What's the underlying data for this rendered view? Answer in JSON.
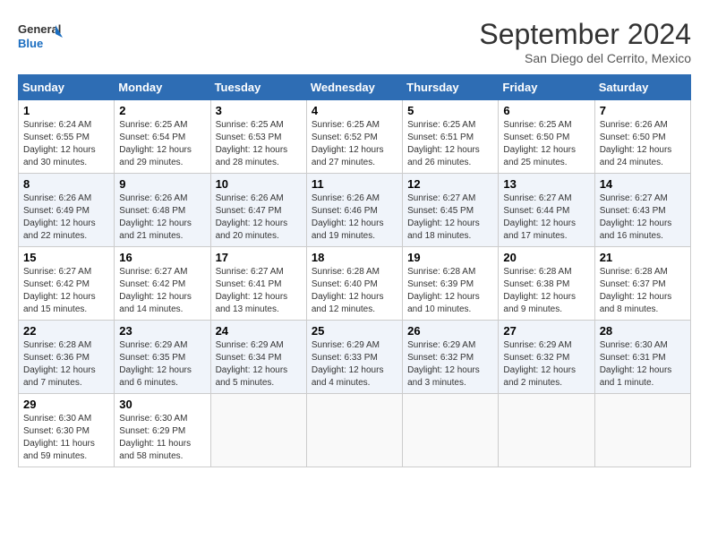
{
  "header": {
    "logo_line1": "General",
    "logo_line2": "Blue",
    "title": "September 2024",
    "subtitle": "San Diego del Cerrito, Mexico"
  },
  "days_of_week": [
    "Sunday",
    "Monday",
    "Tuesday",
    "Wednesday",
    "Thursday",
    "Friday",
    "Saturday"
  ],
  "weeks": [
    [
      {
        "day": "1",
        "sunrise": "6:24 AM",
        "sunset": "6:55 PM",
        "daylight": "12 hours and 30 minutes."
      },
      {
        "day": "2",
        "sunrise": "6:25 AM",
        "sunset": "6:54 PM",
        "daylight": "12 hours and 29 minutes."
      },
      {
        "day": "3",
        "sunrise": "6:25 AM",
        "sunset": "6:53 PM",
        "daylight": "12 hours and 28 minutes."
      },
      {
        "day": "4",
        "sunrise": "6:25 AM",
        "sunset": "6:52 PM",
        "daylight": "12 hours and 27 minutes."
      },
      {
        "day": "5",
        "sunrise": "6:25 AM",
        "sunset": "6:51 PM",
        "daylight": "12 hours and 26 minutes."
      },
      {
        "day": "6",
        "sunrise": "6:25 AM",
        "sunset": "6:50 PM",
        "daylight": "12 hours and 25 minutes."
      },
      {
        "day": "7",
        "sunrise": "6:26 AM",
        "sunset": "6:50 PM",
        "daylight": "12 hours and 24 minutes."
      }
    ],
    [
      {
        "day": "8",
        "sunrise": "6:26 AM",
        "sunset": "6:49 PM",
        "daylight": "12 hours and 22 minutes."
      },
      {
        "day": "9",
        "sunrise": "6:26 AM",
        "sunset": "6:48 PM",
        "daylight": "12 hours and 21 minutes."
      },
      {
        "day": "10",
        "sunrise": "6:26 AM",
        "sunset": "6:47 PM",
        "daylight": "12 hours and 20 minutes."
      },
      {
        "day": "11",
        "sunrise": "6:26 AM",
        "sunset": "6:46 PM",
        "daylight": "12 hours and 19 minutes."
      },
      {
        "day": "12",
        "sunrise": "6:27 AM",
        "sunset": "6:45 PM",
        "daylight": "12 hours and 18 minutes."
      },
      {
        "day": "13",
        "sunrise": "6:27 AM",
        "sunset": "6:44 PM",
        "daylight": "12 hours and 17 minutes."
      },
      {
        "day": "14",
        "sunrise": "6:27 AM",
        "sunset": "6:43 PM",
        "daylight": "12 hours and 16 minutes."
      }
    ],
    [
      {
        "day": "15",
        "sunrise": "6:27 AM",
        "sunset": "6:42 PM",
        "daylight": "12 hours and 15 minutes."
      },
      {
        "day": "16",
        "sunrise": "6:27 AM",
        "sunset": "6:42 PM",
        "daylight": "12 hours and 14 minutes."
      },
      {
        "day": "17",
        "sunrise": "6:27 AM",
        "sunset": "6:41 PM",
        "daylight": "12 hours and 13 minutes."
      },
      {
        "day": "18",
        "sunrise": "6:28 AM",
        "sunset": "6:40 PM",
        "daylight": "12 hours and 12 minutes."
      },
      {
        "day": "19",
        "sunrise": "6:28 AM",
        "sunset": "6:39 PM",
        "daylight": "12 hours and 10 minutes."
      },
      {
        "day": "20",
        "sunrise": "6:28 AM",
        "sunset": "6:38 PM",
        "daylight": "12 hours and 9 minutes."
      },
      {
        "day": "21",
        "sunrise": "6:28 AM",
        "sunset": "6:37 PM",
        "daylight": "12 hours and 8 minutes."
      }
    ],
    [
      {
        "day": "22",
        "sunrise": "6:28 AM",
        "sunset": "6:36 PM",
        "daylight": "12 hours and 7 minutes."
      },
      {
        "day": "23",
        "sunrise": "6:29 AM",
        "sunset": "6:35 PM",
        "daylight": "12 hours and 6 minutes."
      },
      {
        "day": "24",
        "sunrise": "6:29 AM",
        "sunset": "6:34 PM",
        "daylight": "12 hours and 5 minutes."
      },
      {
        "day": "25",
        "sunrise": "6:29 AM",
        "sunset": "6:33 PM",
        "daylight": "12 hours and 4 minutes."
      },
      {
        "day": "26",
        "sunrise": "6:29 AM",
        "sunset": "6:32 PM",
        "daylight": "12 hours and 3 minutes."
      },
      {
        "day": "27",
        "sunrise": "6:29 AM",
        "sunset": "6:32 PM",
        "daylight": "12 hours and 2 minutes."
      },
      {
        "day": "28",
        "sunrise": "6:30 AM",
        "sunset": "6:31 PM",
        "daylight": "12 hours and 1 minute."
      }
    ],
    [
      {
        "day": "29",
        "sunrise": "6:30 AM",
        "sunset": "6:30 PM",
        "daylight": "11 hours and 59 minutes."
      },
      {
        "day": "30",
        "sunrise": "6:30 AM",
        "sunset": "6:29 PM",
        "daylight": "11 hours and 58 minutes."
      },
      null,
      null,
      null,
      null,
      null
    ]
  ]
}
